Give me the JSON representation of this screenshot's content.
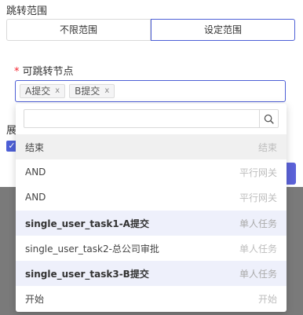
{
  "section_title": "跳转范围",
  "range_tabs": {
    "unlimited": "不限范围",
    "custom": "设定范围"
  },
  "field": {
    "required_mark": "*",
    "label": "可跳转节点"
  },
  "selected_tags": [
    {
      "label": "A提交",
      "remove": "x"
    },
    {
      "label": "B提交",
      "remove": "x"
    }
  ],
  "background": {
    "clipped_label": "展",
    "checkbox": "✓"
  },
  "search": {
    "value": "",
    "placeholder": ""
  },
  "options": [
    {
      "name": "结束",
      "type": "结束"
    },
    {
      "name": "AND",
      "type": "平行网关"
    },
    {
      "name": "AND",
      "type": "平行网关"
    },
    {
      "name": "single_user_task1-A提交",
      "type": "单人任务"
    },
    {
      "name": "single_user_task2-总公司审批",
      "type": "单人任务"
    },
    {
      "name": "single_user_task3-B提交",
      "type": "单人任务"
    },
    {
      "name": "开始",
      "type": "开始"
    }
  ],
  "colors": {
    "accent": "#4d5fd6",
    "required": "#f5222d",
    "selected_bg": "#eef0fb"
  }
}
